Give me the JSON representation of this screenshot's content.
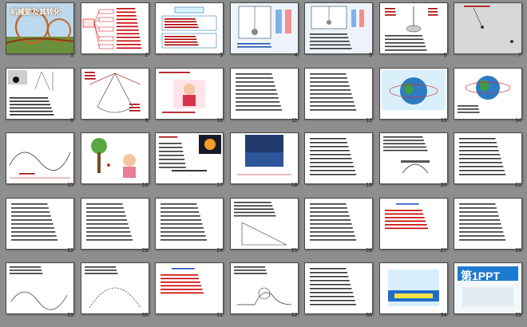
{
  "slide_sorter": {
    "first_slide_title": "机械能及其转化",
    "logo_text": "第1PPT",
    "slides": [
      {
        "number": "1",
        "kind": "title"
      },
      {
        "number": "2",
        "kind": "mindmap"
      },
      {
        "number": "3",
        "kind": "boxtext"
      },
      {
        "number": "4",
        "kind": "pendulum-blue"
      },
      {
        "number": "5",
        "kind": "pendulum-blue2"
      },
      {
        "number": "6",
        "kind": "wheel"
      },
      {
        "number": "7",
        "kind": "grey-pendulum"
      },
      {
        "number": "8",
        "kind": "pendulum-text"
      },
      {
        "number": "9",
        "kind": "pendulum-lines"
      },
      {
        "number": "10",
        "kind": "girl"
      },
      {
        "number": "11",
        "kind": "text"
      },
      {
        "number": "12",
        "kind": "text"
      },
      {
        "number": "13",
        "kind": "earth"
      },
      {
        "number": "14",
        "kind": "earth2"
      },
      {
        "number": "15",
        "kind": "roller"
      },
      {
        "number": "16",
        "kind": "cartoon"
      },
      {
        "number": "17",
        "kind": "sun"
      },
      {
        "number": "18",
        "kind": "night"
      },
      {
        "number": "19",
        "kind": "text"
      },
      {
        "number": "20",
        "kind": "bridge"
      },
      {
        "number": "21",
        "kind": "text"
      },
      {
        "number": "22",
        "kind": "text"
      },
      {
        "number": "23",
        "kind": "text"
      },
      {
        "number": "24",
        "kind": "text"
      },
      {
        "number": "25",
        "kind": "ramp"
      },
      {
        "number": "26",
        "kind": "text"
      },
      {
        "number": "27",
        "kind": "question"
      },
      {
        "number": "28",
        "kind": "text"
      },
      {
        "number": "29",
        "kind": "curve"
      },
      {
        "number": "30",
        "kind": "arc"
      },
      {
        "number": "31",
        "kind": "question"
      },
      {
        "number": "32",
        "kind": "loop"
      },
      {
        "number": "33",
        "kind": "text"
      },
      {
        "number": "34",
        "kind": "ad"
      },
      {
        "number": "35",
        "kind": "logo"
      }
    ]
  }
}
